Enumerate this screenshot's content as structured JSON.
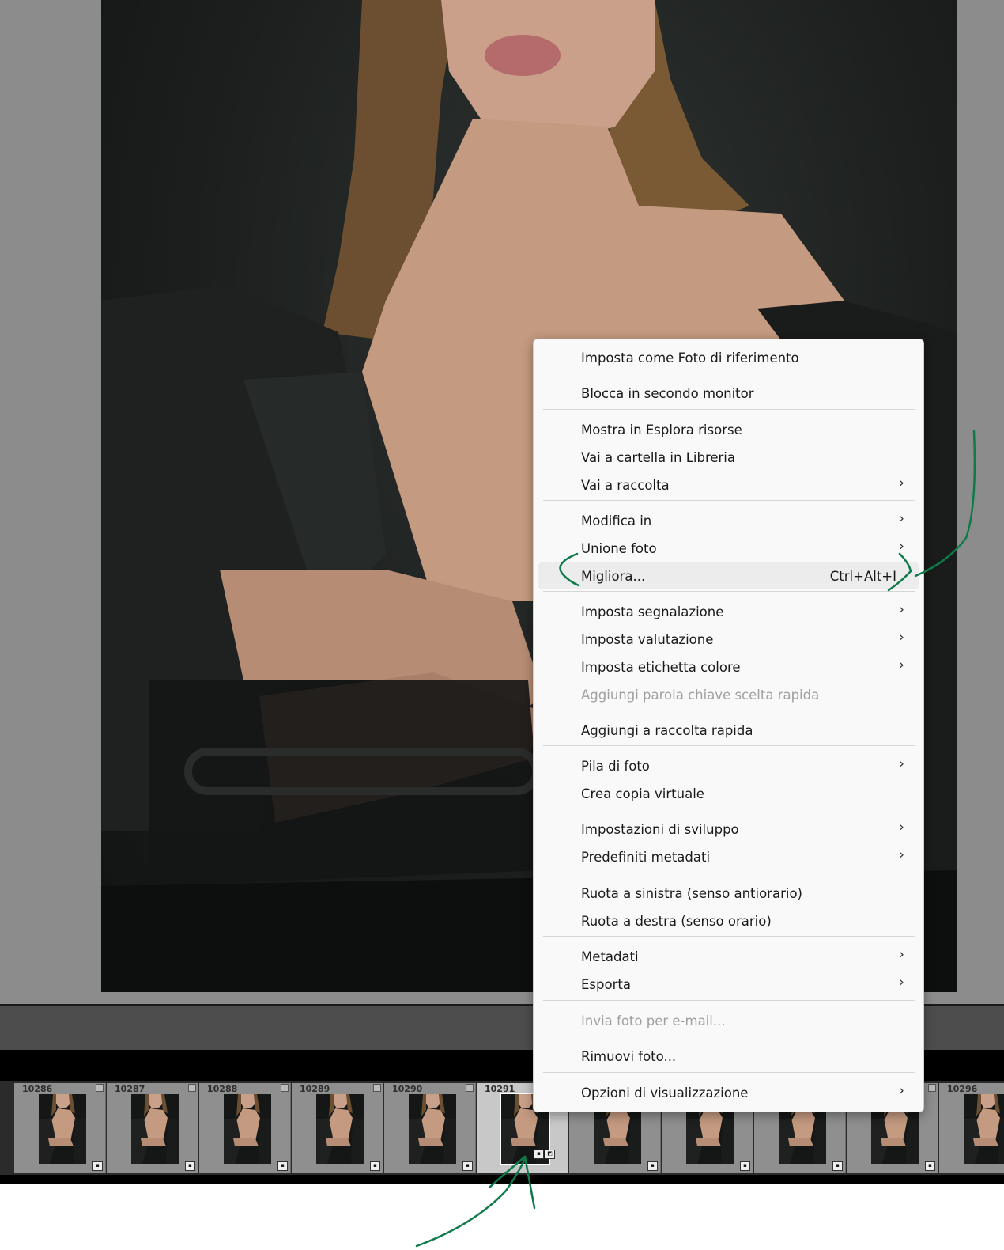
{
  "menu": {
    "items": [
      {
        "label": "Imposta come Foto di riferimento",
        "arrow": "",
        "shortcut": "",
        "disabled": false
      },
      {
        "label": "Blocca in secondo monitor",
        "arrow": "",
        "shortcut": "",
        "disabled": false
      },
      {
        "label": "Mostra in Esplora risorse",
        "arrow": "",
        "shortcut": "",
        "disabled": false
      },
      {
        "label": "Vai a cartella in Libreria",
        "arrow": "",
        "shortcut": "",
        "disabled": false
      },
      {
        "label": "Vai a raccolta",
        "arrow": "›",
        "shortcut": "",
        "disabled": false
      },
      {
        "label": "Modifica in",
        "arrow": "›",
        "shortcut": "",
        "disabled": false
      },
      {
        "label": "Unione foto",
        "arrow": "›",
        "shortcut": "",
        "disabled": false
      },
      {
        "label": "Migliora...",
        "arrow": "",
        "shortcut": "Ctrl+Alt+I",
        "disabled": false,
        "highlighted": true
      },
      {
        "label": "Imposta segnalazione",
        "arrow": "›",
        "shortcut": "",
        "disabled": false
      },
      {
        "label": "Imposta valutazione",
        "arrow": "›",
        "shortcut": "",
        "disabled": false
      },
      {
        "label": "Imposta etichetta colore",
        "arrow": "›",
        "shortcut": "",
        "disabled": false
      },
      {
        "label": "Aggiungi parola chiave scelta rapida",
        "arrow": "",
        "shortcut": "",
        "disabled": true
      },
      {
        "label": "Aggiungi a raccolta rapida",
        "arrow": "",
        "shortcut": "",
        "disabled": false
      },
      {
        "label": "Pila di foto",
        "arrow": "›",
        "shortcut": "",
        "disabled": false
      },
      {
        "label": "Crea copia virtuale",
        "arrow": "",
        "shortcut": "",
        "disabled": false
      },
      {
        "label": "Impostazioni di sviluppo",
        "arrow": "›",
        "shortcut": "",
        "disabled": false
      },
      {
        "label": "Predefiniti metadati",
        "arrow": "›",
        "shortcut": "",
        "disabled": false
      },
      {
        "label": "Ruota a sinistra (senso antiorario)",
        "arrow": "",
        "shortcut": "",
        "disabled": false
      },
      {
        "label": "Ruota a destra (senso orario)",
        "arrow": "",
        "shortcut": "",
        "disabled": false
      },
      {
        "label": "Metadati",
        "arrow": "›",
        "shortcut": "",
        "disabled": false
      },
      {
        "label": "Esporta",
        "arrow": "›",
        "shortcut": "",
        "disabled": false
      },
      {
        "label": "Invia foto per e-mail...",
        "arrow": "",
        "shortcut": "",
        "disabled": true
      },
      {
        "label": "Rimuovi foto...",
        "arrow": "",
        "shortcut": "",
        "disabled": false
      },
      {
        "label": "Opzioni di visualizzazione",
        "arrow": "›",
        "shortcut": "",
        "disabled": false
      }
    ]
  },
  "filmstrip": {
    "cells": [
      {
        "num": "10286"
      },
      {
        "num": "10287"
      },
      {
        "num": "10288"
      },
      {
        "num": "10289"
      },
      {
        "num": "10290"
      },
      {
        "num": "10291",
        "selected": true
      },
      {
        "num": ""
      },
      {
        "num": ""
      },
      {
        "num": ""
      },
      {
        "num": ""
      },
      {
        "num": "10296"
      }
    ]
  },
  "colors": {
    "menu_bg": "#f9f9f9",
    "annotation_green": "#0f7a4a",
    "filmstrip_cell": "#8f8f8f"
  },
  "icons": {
    "submenu": "chevron-right-icon",
    "thumbnail_badge": "comment-badge-icon",
    "edit_badge": "develop-adjusted-icon"
  }
}
